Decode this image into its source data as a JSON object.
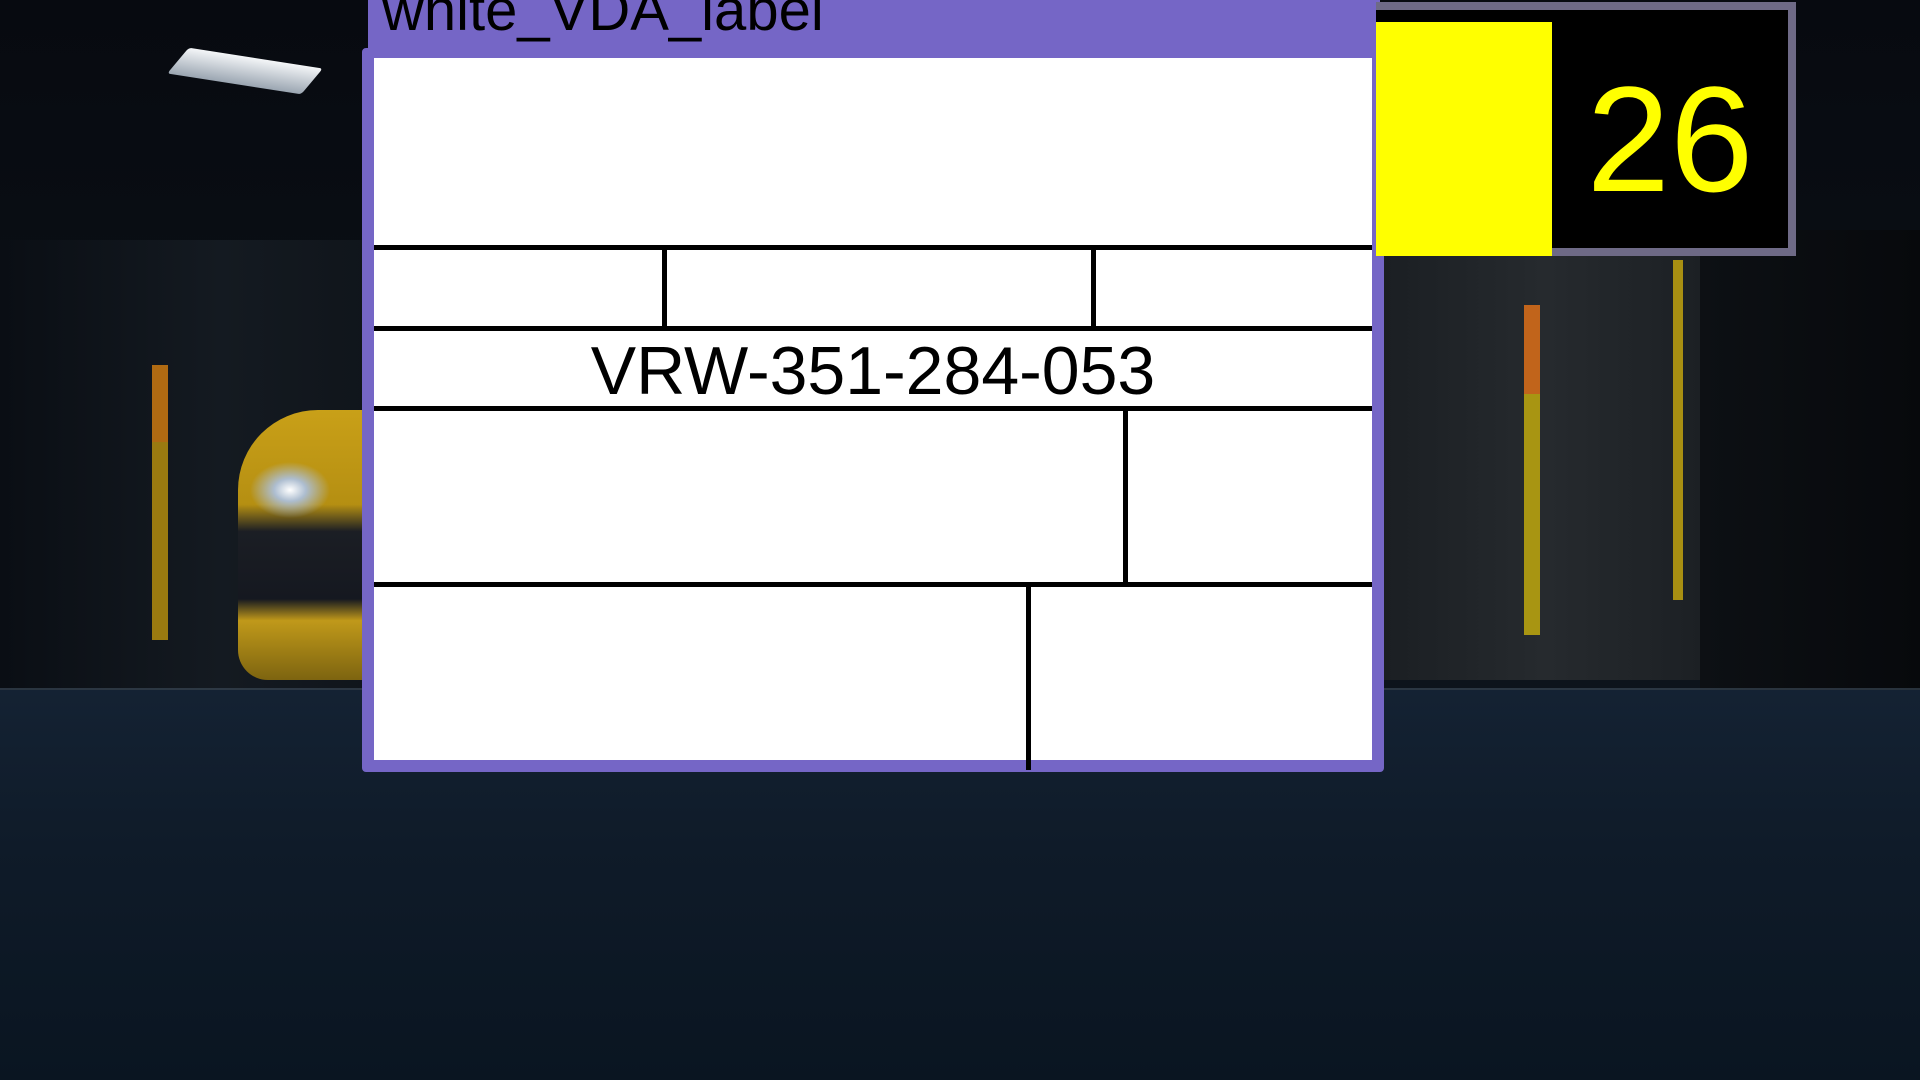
{
  "window": {
    "title": "white_VDA_label"
  },
  "label": {
    "serial_number": "VRW-351-284-053"
  },
  "counter": {
    "value": "26"
  },
  "colors": {
    "accent": "#7566c6",
    "counter_highlight": "#ffff00",
    "label_background": "#ffffff"
  }
}
